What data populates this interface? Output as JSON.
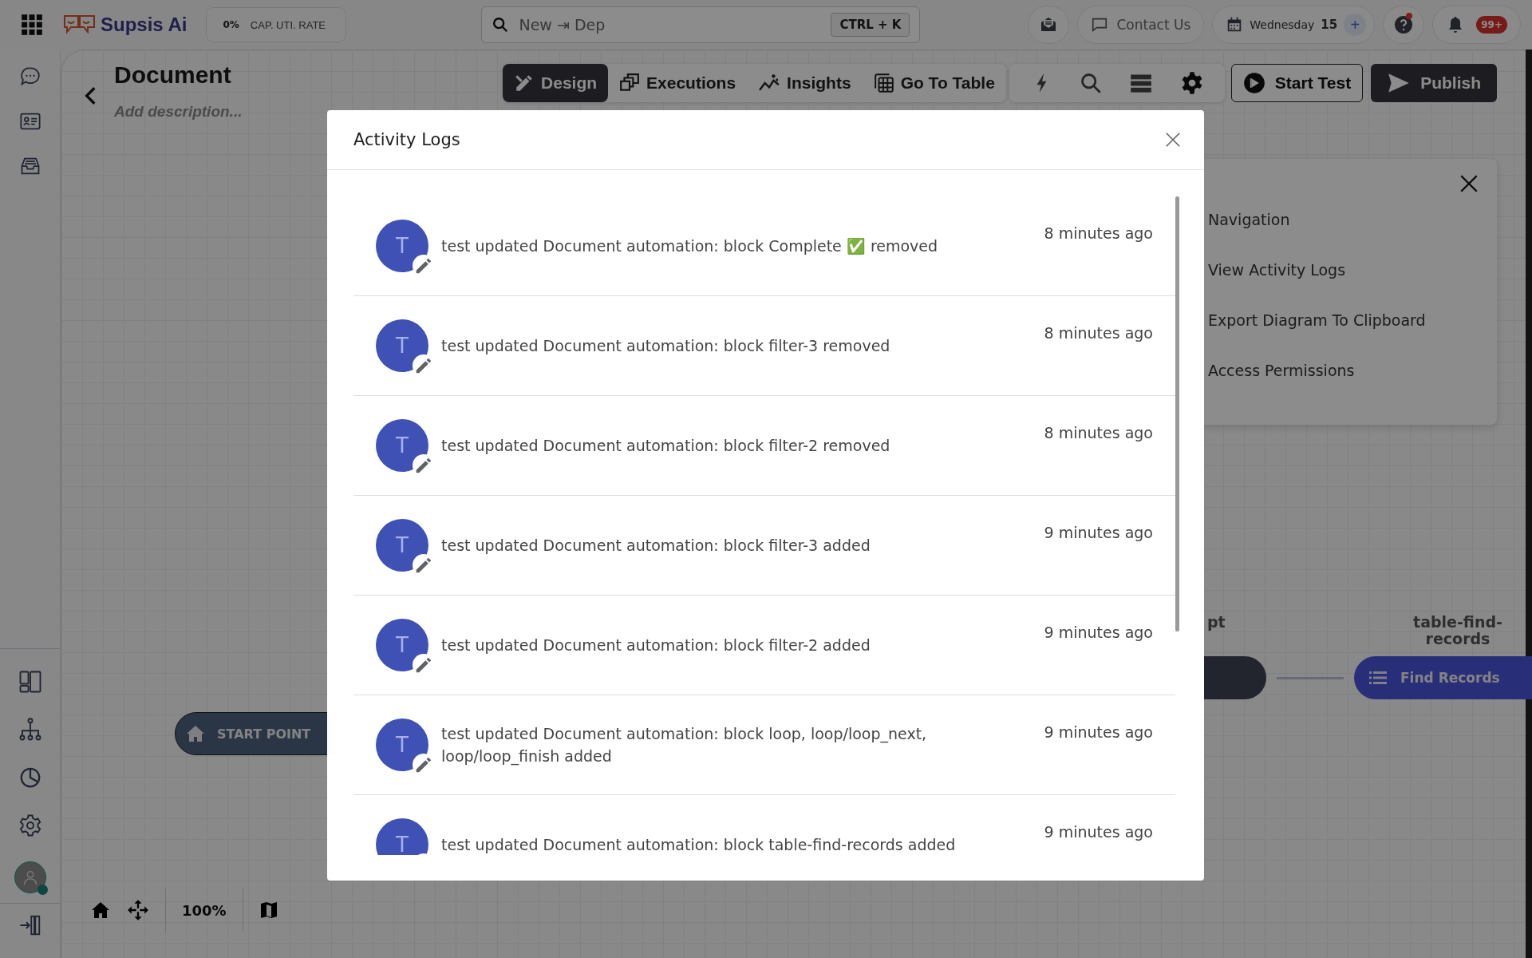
{
  "topbar": {
    "brand": "Supsis Ai",
    "cap_rate": {
      "value": "0%",
      "label": "CAP. UTI. RATE"
    },
    "search": {
      "value": "New ⇥ Dep",
      "shortcut": "CTRL + K"
    },
    "contact": "Contact Us",
    "date": {
      "day": "Wednesday",
      "number": "15",
      "add": "+"
    },
    "help_unread": true,
    "notifications": "99+"
  },
  "header": {
    "title": "Document",
    "description_placeholder": "Add description...",
    "tabs": [
      {
        "label": "Design",
        "selected": true
      },
      {
        "label": "Executions",
        "selected": false
      },
      {
        "label": "Insights",
        "selected": false
      },
      {
        "label": "Go To Table",
        "selected": false
      }
    ],
    "start_test": "Start Test",
    "publish": "Publish"
  },
  "menu": {
    "items": [
      "Navigation",
      "View Activity Logs",
      "Export Diagram To Clipboard",
      "Access Permissions"
    ]
  },
  "canvas": {
    "nodes": [
      {
        "kind": "start",
        "label": "START POINT"
      },
      {
        "kind": "dark",
        "caption": "pt"
      },
      {
        "kind": "find",
        "caption": "table-find-records",
        "label": "Find Records"
      }
    ],
    "zoom": "100%"
  },
  "modal": {
    "title": "Activity Logs",
    "logs": [
      {
        "initial": "T",
        "text": "test updated Document automation: block Complete ✅ removed",
        "time": "8 minutes ago"
      },
      {
        "initial": "T",
        "text": "test updated Document automation: block filter-3 removed",
        "time": "8 minutes ago"
      },
      {
        "initial": "T",
        "text": "test updated Document automation: block filter-2 removed",
        "time": "8 minutes ago"
      },
      {
        "initial": "T",
        "text": "test updated Document automation: block filter-3 added",
        "time": "9 minutes ago"
      },
      {
        "initial": "T",
        "text": "test updated Document automation: block filter-2 added",
        "time": "9 minutes ago"
      },
      {
        "initial": "T",
        "text": "test updated Document automation: block loop, loop/loop_next, loop/loop_finish added",
        "time": "9 minutes ago"
      },
      {
        "initial": "T",
        "text": "test updated Document automation: block table-find-records added",
        "time": "9 minutes ago"
      }
    ]
  }
}
